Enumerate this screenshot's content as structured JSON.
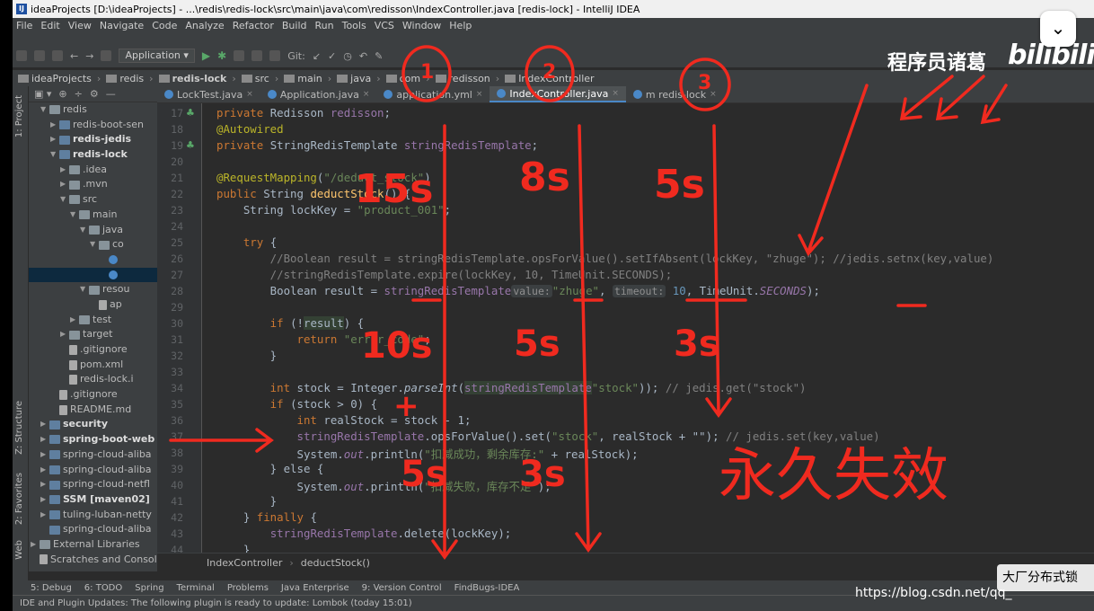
{
  "window": {
    "title": "ideaProjects [D:\\ideaProjects] - ...\\redis\\redis-lock\\src\\main\\java\\com\\redisson\\IndexController.java [redis-lock] - IntelliJ IDEA",
    "app_icon": "IJ"
  },
  "menu": [
    "File",
    "Edit",
    "View",
    "Navigate",
    "Code",
    "Analyze",
    "Refactor",
    "Build",
    "Run",
    "Tools",
    "VCS",
    "Window",
    "Help"
  ],
  "toolbar": {
    "run_config": "Application ▾",
    "git_label": "Git:"
  },
  "navbar": [
    "ideaProjects",
    "redis",
    "redis-lock",
    "src",
    "main",
    "java",
    "com",
    "redisson",
    "IndexController"
  ],
  "sidebar": {
    "project_tab": "1: Project",
    "structure_tab": "Z: Structure",
    "favorites_tab": "2: Favorites",
    "web_tab": "Web"
  },
  "tree": [
    {
      "label": "redis",
      "indent": 1,
      "arrow": "▼",
      "bold": false,
      "icon": "folder"
    },
    {
      "label": "redis-boot-sen",
      "indent": 2,
      "arrow": "▶",
      "bold": false,
      "icon": "mod"
    },
    {
      "label": "redis-jedis",
      "indent": 2,
      "arrow": "▶",
      "bold": true,
      "icon": "mod"
    },
    {
      "label": "redis-lock",
      "indent": 2,
      "arrow": "▼",
      "bold": true,
      "icon": "mod"
    },
    {
      "label": ".idea",
      "indent": 3,
      "arrow": "▶",
      "bold": false,
      "icon": "folder"
    },
    {
      "label": ".mvn",
      "indent": 3,
      "arrow": "▶",
      "bold": false,
      "icon": "folder"
    },
    {
      "label": "src",
      "indent": 3,
      "arrow": "▼",
      "bold": false,
      "icon": "folder"
    },
    {
      "label": "main",
      "indent": 4,
      "arrow": "▼",
      "bold": false,
      "icon": "folder"
    },
    {
      "label": "java",
      "indent": 5,
      "arrow": "▼",
      "bold": false,
      "icon": "folder"
    },
    {
      "label": "co",
      "indent": 6,
      "arrow": "▼",
      "bold": false,
      "icon": "folder"
    },
    {
      "label": "",
      "indent": 7,
      "arrow": "",
      "bold": false,
      "icon": "class"
    },
    {
      "label": "",
      "indent": 7,
      "arrow": "",
      "bold": false,
      "icon": "class",
      "selected": true
    },
    {
      "label": "resou",
      "indent": 5,
      "arrow": "▼",
      "bold": false,
      "icon": "folder"
    },
    {
      "label": "ap",
      "indent": 6,
      "arrow": "",
      "bold": false,
      "icon": "file"
    },
    {
      "label": "test",
      "indent": 4,
      "arrow": "▶",
      "bold": false,
      "icon": "folder"
    },
    {
      "label": "target",
      "indent": 3,
      "arrow": "▶",
      "bold": false,
      "icon": "folder"
    },
    {
      "label": ".gitignore",
      "indent": 3,
      "arrow": "",
      "bold": false,
      "icon": "file"
    },
    {
      "label": "pom.xml",
      "indent": 3,
      "arrow": "",
      "bold": false,
      "icon": "file"
    },
    {
      "label": "redis-lock.i",
      "indent": 3,
      "arrow": "",
      "bold": false,
      "icon": "file"
    },
    {
      "label": ".gitignore",
      "indent": 2,
      "arrow": "",
      "bold": false,
      "icon": "file"
    },
    {
      "label": "README.md",
      "indent": 2,
      "arrow": "",
      "bold": false,
      "icon": "file"
    },
    {
      "label": "security",
      "indent": 1,
      "arrow": "▶",
      "bold": true,
      "icon": "mod"
    },
    {
      "label": "spring-boot-web",
      "indent": 1,
      "arrow": "▶",
      "bold": true,
      "icon": "mod"
    },
    {
      "label": "spring-cloud-aliba",
      "indent": 1,
      "arrow": "▶",
      "bold": false,
      "icon": "mod"
    },
    {
      "label": "spring-cloud-aliba",
      "indent": 1,
      "arrow": "▶",
      "bold": false,
      "icon": "mod"
    },
    {
      "label": "spring-cloud-netfl",
      "indent": 1,
      "arrow": "▶",
      "bold": false,
      "icon": "mod"
    },
    {
      "label": "SSM [maven02]",
      "indent": 1,
      "arrow": "▶",
      "bold": true,
      "icon": "mod"
    },
    {
      "label": "tuling-luban-netty",
      "indent": 1,
      "arrow": "▶",
      "bold": false,
      "icon": "mod"
    },
    {
      "label": "spring-cloud-aliba",
      "indent": 1,
      "arrow": "",
      "bold": false,
      "icon": "mod"
    },
    {
      "label": "External Libraries",
      "indent": 0,
      "arrow": "▶",
      "bold": false,
      "icon": "lib"
    },
    {
      "label": "Scratches and Consol",
      "indent": 0,
      "arrow": "",
      "bold": false,
      "icon": "file"
    }
  ],
  "tabs": [
    {
      "label": "LockTest.java",
      "active": false
    },
    {
      "label": "Application.java",
      "active": false
    },
    {
      "label": "application.yml",
      "active": false
    },
    {
      "label": "IndexController.java",
      "active": true
    },
    {
      "label": "m redis-lock",
      "active": false
    }
  ],
  "line_numbers": [
    "17",
    "18",
    "19",
    "20",
    "21",
    "22",
    "23",
    "24",
    "25",
    "26",
    "27",
    "28",
    "29",
    "30",
    "31",
    "32",
    "33",
    "34",
    "35",
    "36",
    "37",
    "38",
    "39",
    "40",
    "41",
    "42",
    "43",
    "44"
  ],
  "code": {
    "l17": {
      "kw": "private ",
      "rest": "Redisson ",
      "fd": "redisson",
      "end": ";"
    },
    "l18": "@Autowired",
    "l19": {
      "kw": "private ",
      "rest": "StringRedisTemplate ",
      "fd": "stringRedisTemplate",
      "end": ";"
    },
    "l21": {
      "an": "@RequestMapping",
      "open": "(",
      "st": "\"/deduct_stock\"",
      "close": ")"
    },
    "l22": {
      "kw": "public ",
      "rest": "String ",
      "mt": "deductStock",
      "end": "() {"
    },
    "l23": {
      "pre": "    String lockKey = ",
      "st": "\"product_001\"",
      "end": ";"
    },
    "l25": {
      "kw": "    try ",
      "end": "{"
    },
    "l26": "        //Boolean result = stringRedisTemplate.opsForValue().setIfAbsent(lockKey, \"zhuge\"); //jedis.setnx(key,value)",
    "l27": "        //stringRedisTemplate.expire(lockKey, 10, TimeUnit.SECONDS);",
    "l28": {
      "pre": "        Boolean result = ",
      "fd": "stringRedisTemplate",
      ".": ".opsForValue().setIfAbsent(lockKey, ",
      "hint1": "value:",
      "st": "\"zhuge\"",
      "comma": ", ",
      "hint2": "timeout:",
      "num": " 10",
      "post": ", TimeUnit.",
      "cst": "SECONDS",
      "end": ");"
    },
    "l30": {
      "kw": "        if ",
      "pre": "(!",
      "hl": "result",
      "end": ") {"
    },
    "l31": {
      "kw": "            return ",
      "st": "\"error_code\"",
      "end": ";"
    },
    "l32": "        }",
    "l34": {
      "kw": "        int ",
      "pre": "stock = Integer.",
      "it": "parseInt",
      "o": "(",
      "fd": "stringRedisTemplate",
      ".": ".opsForValue().get(",
      "st": "\"stock\"",
      "end": ")); ",
      "cm": "// jedis.get(\"stock\")"
    },
    "l35": {
      "kw": "        if ",
      "end": "(stock > 0) {"
    },
    "l36": {
      "kw": "            int ",
      "end": "realStock = stock - 1;"
    },
    "l37": {
      "pre": "            ",
      "fd": "stringRedisTemplate",
      "mid": ".opsForValue().set(",
      "st": "\"stock\"",
      "end": ", realStock + \"\"); ",
      "cm": "// jedis.set(key,value)"
    },
    "l38": {
      "pre": "            System.",
      "fd": "out",
      "mid": ".println(",
      "st": "\"扣减成功，剩余库存:\"",
      "end": " + realStock);"
    },
    "l39": "        } else {",
    "l40": {
      "pre": "            System.",
      "fd": "out",
      "mid": ".println(",
      "st": "\"扣减失败，库存不足\"",
      "end": ");"
    },
    "l41": "        }",
    "l42": {
      "pre": "    } ",
      "kw": "finally ",
      "end": "{"
    },
    "l43": {
      "pre": "        ",
      "fd": "stringRedisTemplate",
      "end": ".delete(lockKey);"
    },
    "l44": "    }"
  },
  "breadcrumb": [
    "IndexController",
    "deductStock()"
  ],
  "bottom_tabs": [
    "5: Debug",
    "6: TODO",
    "Spring",
    "Terminal",
    "Problems",
    "Java Enterprise",
    "9: Version Control",
    "FindBugs-IDEA"
  ],
  "status": "IDE and Plugin Updates: The following plugin is ready to update: Lombok (today 15:01)",
  "watermark": {
    "channel": "程序员诸葛",
    "logo": "bilibili",
    "ad": "大厂分布式锁",
    "url": "https://blog.csdn.net/qq_"
  },
  "annotations": {
    "circles": [
      "1",
      "2",
      "3"
    ],
    "times_top": [
      "15s",
      "8s",
      "5s"
    ],
    "times_mid": [
      "10s",
      "5s",
      "3s"
    ],
    "times_low": [
      "5s",
      "3s"
    ],
    "plus": "+",
    "permanent_fail": "永久失效"
  },
  "colors": {
    "bg": "#2b2b2b",
    "panel": "#3c3f41",
    "keyword": "#cc7832",
    "string": "#6a8759",
    "field": "#9876aa",
    "annotation_red": "#f02a1f"
  }
}
